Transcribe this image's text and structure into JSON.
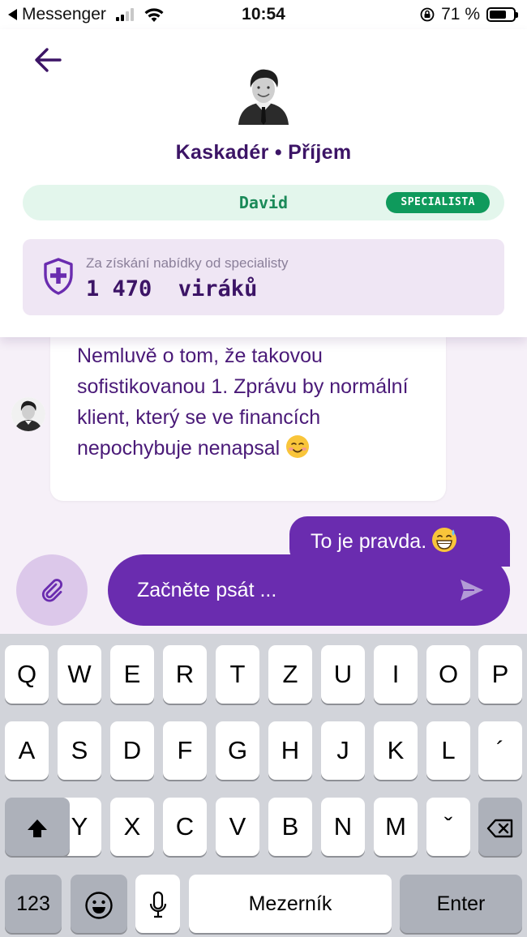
{
  "status_bar": {
    "back_app": "Messenger",
    "time": "10:54",
    "battery": "71 %",
    "battery_level": 0.71
  },
  "header": {
    "title": "Kaskadér • Příjem",
    "specialist_name": "David",
    "specialist_badge": "SPECIALISTA",
    "reward_label": "Za získání nabídky od specialisty",
    "reward_value": "1 470  viráků"
  },
  "messages": [
    {
      "direction": "incoming",
      "text": "Nemluvě o tom, že takovou sofistikovanou 1. Zprávu by normální klient, který se ve financích nepochybuje nenapsal",
      "emoji": "smiling-face-icon"
    },
    {
      "direction": "outgoing",
      "text": "To je pravda.",
      "emoji": "grinning-sweat-face-icon"
    }
  ],
  "composer": {
    "placeholder": "Začněte psát ..."
  },
  "keyboard": {
    "row1": [
      "Q",
      "W",
      "E",
      "R",
      "T",
      "Z",
      "U",
      "I",
      "O",
      "P"
    ],
    "row2": [
      "A",
      "S",
      "D",
      "F",
      "G",
      "H",
      "J",
      "K",
      "L",
      "´"
    ],
    "row3": [
      "Y",
      "X",
      "C",
      "V",
      "B",
      "N",
      "M",
      "ˇ"
    ],
    "numbers_key": "123",
    "space_key": "Mezerník",
    "enter_key": "Enter"
  },
  "colors": {
    "brand_purple": "#6a2caf",
    "title_purple": "#3c1466",
    "specialist_green": "#0f9a5c",
    "specialist_bg": "#e3f6ec",
    "reward_bg": "#efe6f4",
    "chat_bg": "#f6f0f8"
  }
}
